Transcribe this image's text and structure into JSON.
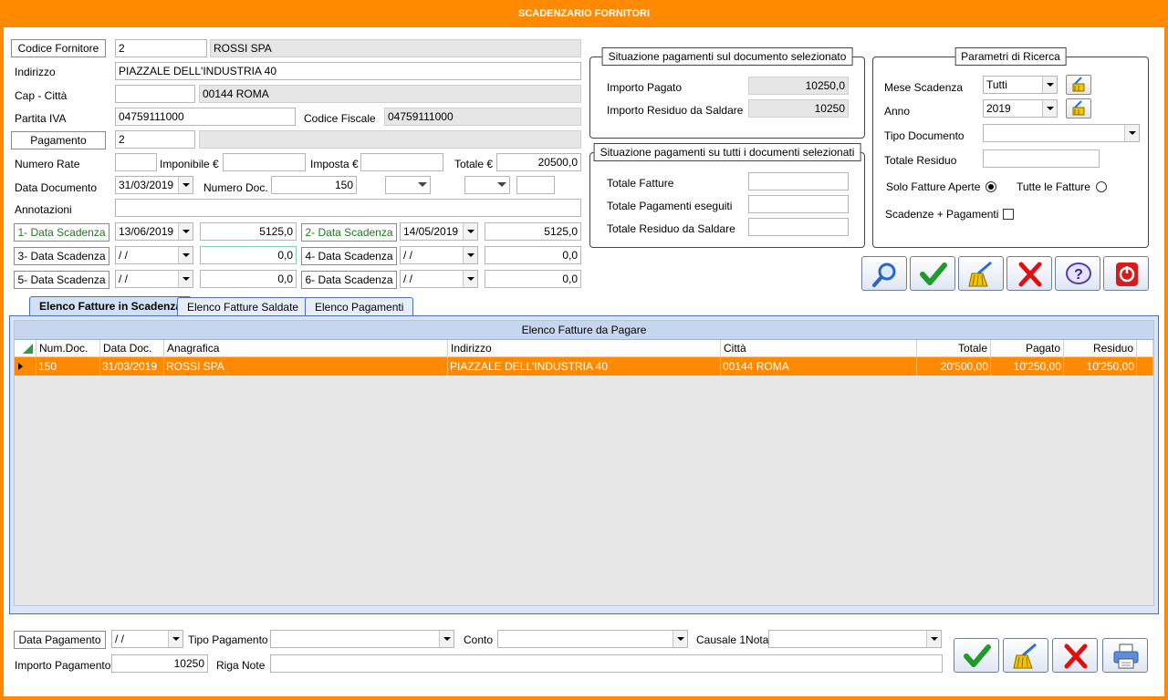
{
  "window": {
    "title": "SCADENZARIO FORNITORI"
  },
  "supplier": {
    "code_button": "Codice Fornitore",
    "code": "2",
    "name": "ROSSI SPA",
    "address_label": "Indirizzo",
    "address": "PIAZZALE DELL'INDUSTRIA 40",
    "cap_label": "Cap - Città",
    "cap": "",
    "city": "00144 ROMA",
    "vat_label": "Partita IVA",
    "vat": "04759111000",
    "fiscal_label": "Codice Fiscale",
    "fiscal": "04759111000",
    "payment_button": "Pagamento",
    "payment_code": "2",
    "payment_desc": ""
  },
  "document": {
    "rate_label": "Numero Rate",
    "rate": "",
    "imponibile_label": "Imponibile €",
    "imponibile": "",
    "imposta_label": "Imposta €",
    "imposta": "",
    "totale_label": "Totale €",
    "totale": "20500,0",
    "date_label": "Data Documento",
    "date": "31/03/2019",
    "number_label": "Numero Doc.",
    "number": "150",
    "annot_label": "Annotazioni",
    "annot": ""
  },
  "deadlines": [
    {
      "label": "1- Data Scadenza",
      "date": "13/06/2019",
      "amount": "5125,0"
    },
    {
      "label": "2- Data Scadenza",
      "date": "14/05/2019",
      "amount": "5125,0"
    },
    {
      "label": "3- Data Scadenza",
      "date": " / /",
      "amount": "0,0"
    },
    {
      "label": "4- Data Scadenza",
      "date": " / /",
      "amount": "0,0"
    },
    {
      "label": "5- Data Scadenza",
      "date": " / /",
      "amount": "0,0"
    },
    {
      "label": "6- Data Scadenza",
      "date": " / /",
      "amount": "0,0"
    }
  ],
  "situation_doc": {
    "title": "Situazione pagamenti sul documento selezionato",
    "paid_label": "Importo Pagato",
    "paid": "10250,0",
    "residual_label": "Importo Residuo da Saldare",
    "residual": "10250"
  },
  "situation_all": {
    "title": "Situazione pagamenti su tutti i documenti selezionati",
    "invoices_label": "Totale Fatture",
    "invoices": "",
    "payments_label": "Totale Pagamenti eseguiti",
    "payments": "",
    "residual_label": "Totale Residuo da Saldare",
    "residual": ""
  },
  "search": {
    "title": "Parametri di Ricerca",
    "month_label": "Mese Scadenza",
    "month": "Tutti",
    "year_label": "Anno",
    "year": "2019",
    "doctype_label": "Tipo Documento",
    "doctype": "",
    "total_res_label": "Totale Residuo",
    "total_res": "",
    "open_label": "Solo Fatture Aperte",
    "all_label": "Tutte le Fatture",
    "combined_label": "Scadenze + Pagamenti"
  },
  "toolbar_icons": [
    "search-icon",
    "check-icon",
    "broom-icon",
    "close-icon",
    "help-icon",
    "power-icon"
  ],
  "tabs": [
    {
      "label": "Elenco Fatture in Scadenza"
    },
    {
      "label": "Elenco Fatture Saldate"
    },
    {
      "label": "Elenco Pagamenti"
    }
  ],
  "grid": {
    "title": "Elenco Fatture da Pagare",
    "columns": [
      "Num.Doc.",
      "Data Doc.",
      "Anagrafica",
      "Indirizzo",
      "Città",
      "Totale",
      "Pagato",
      "Residuo"
    ],
    "rows": [
      [
        "150",
        "31/03/2019",
        "ROSSI SPA",
        "PIAZZALE DELL'INDUSTRIA 40",
        "00144 ROMA",
        "20'500,00",
        "10'250,00",
        "10'250,00"
      ]
    ]
  },
  "payment": {
    "date_button": "Data Pagamento",
    "date": " / /",
    "type_label": "Tipo Pagamento",
    "type": "",
    "account_label": "Conto",
    "account": "",
    "cause_label": "Causale 1Nota",
    "cause": "",
    "amount_label": "Importo Pagamento",
    "amount": "10250",
    "note_label": "Riga Note",
    "note": ""
  },
  "colors": {
    "accent": "#ff8a00",
    "tab_border": "#4a6fb5"
  }
}
